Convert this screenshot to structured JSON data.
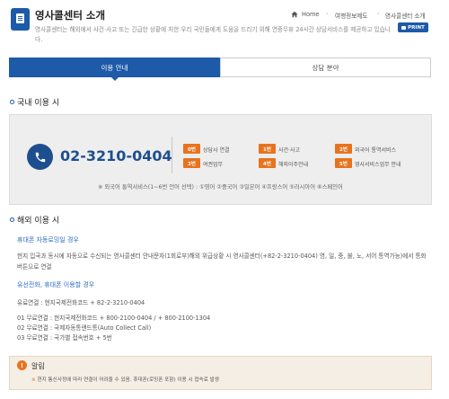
{
  "header": {
    "title": "영사콜센터 소개",
    "description": "영사콜센터는 해외에서 사건·사고 또는 긴급한 상황에 처한 우리 국민들에게 도움을 드리기 위해 연중무휴 24시간 상담서비스를 제공하고 있습니다.",
    "breadcrumb": [
      "Home",
      "여행정보제도",
      "영사콜센터 소개"
    ],
    "print_label": "PRINT"
  },
  "tabs": [
    {
      "label": "이용 안내",
      "active": true
    },
    {
      "label": "상담 분야",
      "active": false
    }
  ],
  "domestic": {
    "title": "국내 이용 시",
    "phone": "02-3210-0404",
    "options": [
      {
        "badge": "0번",
        "label": "상담사 연결"
      },
      {
        "badge": "1번",
        "label": "사건·사고"
      },
      {
        "badge": "2번",
        "label": "외국어 통역서비스"
      },
      {
        "badge": "3번",
        "label": "여권업무"
      },
      {
        "badge": "4번",
        "label": "해외이주안내"
      },
      {
        "badge": "5번",
        "label": "영사서비스업무 안내"
      }
    ],
    "language_note": "※ 외국어 통역서비스(1~6번 언어 선택) : ①영어 ②중국어 ③일본어 ④프랑스어 ⑤러시아어 ⑥스페인어"
  },
  "overseas": {
    "title": "해외 이용 시",
    "roaming": {
      "heading": "휴대폰 자동로밍일 경우",
      "text": "현지 입국과 동시에 자동으로 수신되는 영사콜센터 안내문자(1회로부)해외 위급상황 시 영사콜센터(+82-2-3210-0404) 영, 일, 중, 불, 노, 서어 통역가능)에서 통화 버튼으로 연결"
    },
    "landline": {
      "heading": "유선전화, 휴대폰 이용할 경우",
      "paid": "유료연결 : 현지국제전화코드 + 82-2-3210-0404",
      "free": [
        "01 무료연결 : 현지국제전화코드 + 800-2100-0404 / + 800-2100-1304",
        "02 무료연결 : 국제자동통랜드통(Auto Collect Call)",
        "03 무료연결 : 국가별 접속번호 + 5번"
      ]
    }
  },
  "notice": {
    "icon_text": "!",
    "title": "알림",
    "text_mark": "※",
    "text": "현지 통신사정에 따라 연결이 어려울 수 있음. 휴대폰(로밍폰 포함) 이용 시 접속료 발생"
  },
  "colors": {
    "primary": "#1d5aa8",
    "accent": "#e8731f",
    "link": "#2a6cc0"
  }
}
